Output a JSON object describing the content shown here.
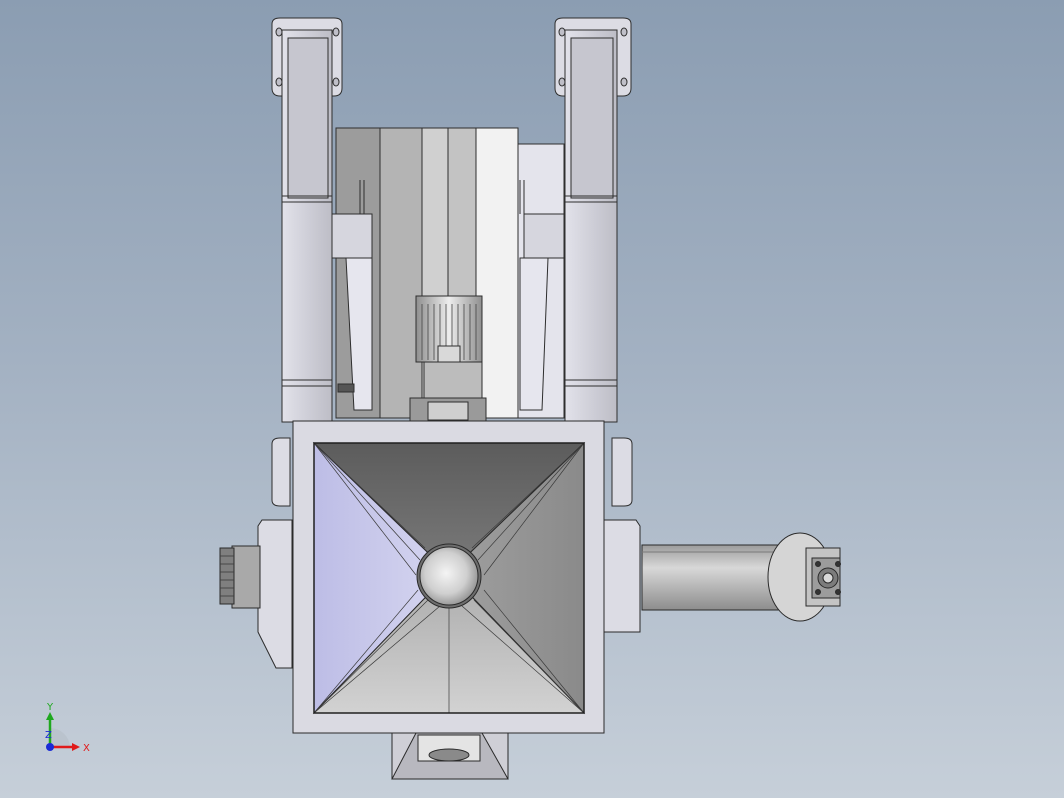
{
  "viewport": {
    "background_top": "#8b9db2",
    "background_bottom": "#c6cfd9"
  },
  "model": {
    "view": "top",
    "parts": [
      "left-guide-column",
      "right-guide-column",
      "slide-block",
      "gear-motor",
      "hopper",
      "hopper-outlet-ring",
      "discharge-pipe",
      "pipe-end-flange",
      "left-cable-gland",
      "bottom-nozzle"
    ]
  },
  "triad": {
    "x_label": "X",
    "y_label": "Y",
    "z_label": "Z",
    "x_color": "#e01a1a",
    "y_color": "#1fa81f",
    "z_color": "#1a2bd6"
  }
}
